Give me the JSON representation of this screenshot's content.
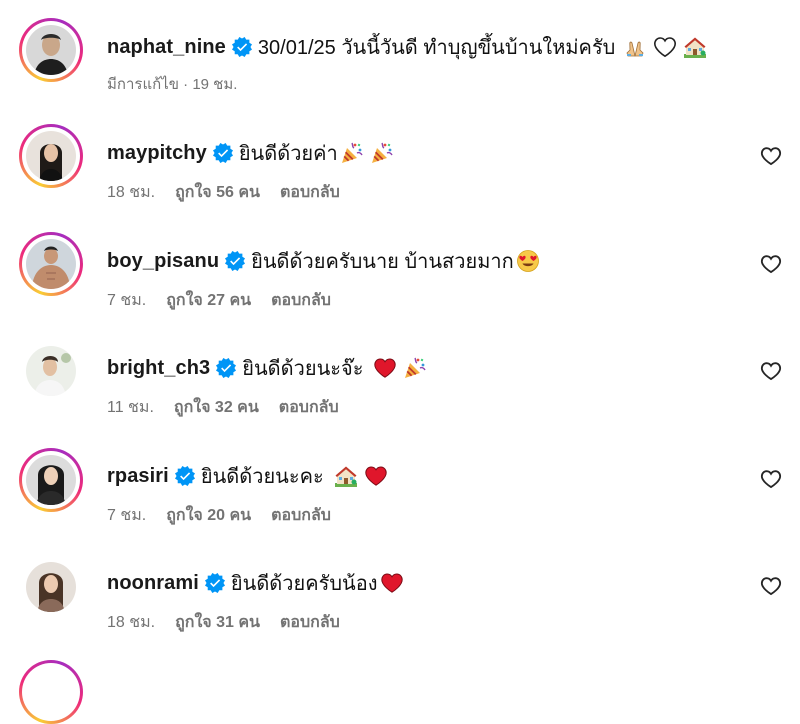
{
  "post": {
    "username": "naphat_nine",
    "caption": "30/01/25 วันนี้วันดี ทำบุญขึ้นบ้านใหม่ครับ",
    "meta": "มีการแก้ไข · 19 ชม."
  },
  "comments": [
    {
      "username": "maypitchy",
      "text": "ยินดีด้วยค่า",
      "time": "18 ชม.",
      "likes": "ถูกใจ 56 คน",
      "reply": "ตอบกลับ"
    },
    {
      "username": "boy_pisanu",
      "text": "ยินดีด้วยครับนาย บ้านสวยมาก",
      "time": "7 ชม.",
      "likes": "ถูกใจ 27 คน",
      "reply": "ตอบกลับ"
    },
    {
      "username": "bright_ch3",
      "text": "ยินดีด้วยนะจ๊ะ",
      "time": "11 ชม.",
      "likes": "ถูกใจ 32 คน",
      "reply": "ตอบกลับ"
    },
    {
      "username": "rpasiri",
      "text": "ยินดีด้วยนะคะ",
      "time": "7 ชม.",
      "likes": "ถูกใจ 20 คน",
      "reply": "ตอบกลับ"
    },
    {
      "username": "noonrami",
      "text": "ยินดีด้วยครับน้อง",
      "time": "18 ชม.",
      "likes": "ถูกใจ 31 คน",
      "reply": "ตอบกลับ"
    }
  ],
  "icons": {
    "verified": "verified-badge-icon",
    "like": "heart-outline-icon",
    "emojis": [
      "folded-hands",
      "white-heart",
      "house-with-garden",
      "party-popper",
      "smiling-face-with-heart-eyes",
      "red-heart"
    ]
  },
  "colors": {
    "verified": "#0095f6",
    "muted": "#737373",
    "heart_red": "#e0162b"
  }
}
